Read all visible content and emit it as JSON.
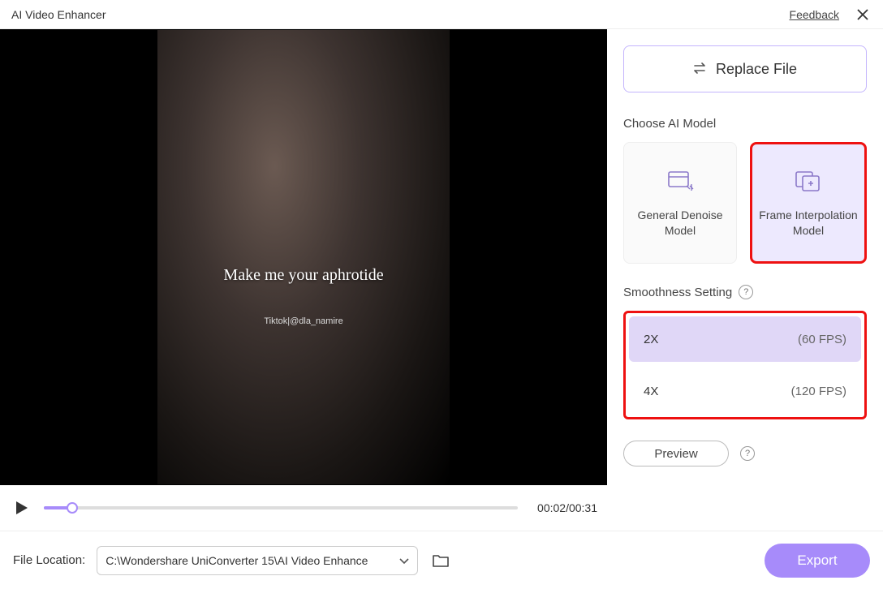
{
  "titlebar": {
    "title": "AI Video Enhancer",
    "feedback": "Feedback"
  },
  "video": {
    "caption1": "Make me your aphrotide",
    "caption2": "Tiktok|@dla_namire",
    "time": "00:02/00:31"
  },
  "sidebar": {
    "replace_label": "Replace File",
    "choose_model_label": "Choose AI Model",
    "models": [
      {
        "label": "General Denoise Model"
      },
      {
        "label": "Frame Interpolation Model"
      }
    ],
    "smoothness_label": "Smoothness Setting",
    "smooth_options": [
      {
        "mult": "2X",
        "fps": "(60 FPS)"
      },
      {
        "mult": "4X",
        "fps": "(120 FPS)"
      }
    ],
    "preview_label": "Preview"
  },
  "footer": {
    "location_label": "File Location:",
    "path": "C:\\Wondershare UniConverter 15\\AI Video Enhance",
    "export_label": "Export"
  }
}
